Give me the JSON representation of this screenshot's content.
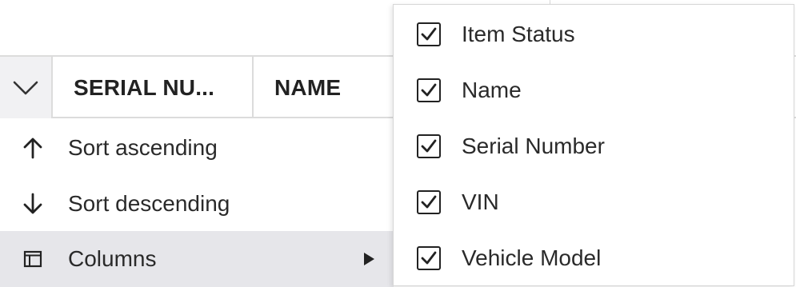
{
  "grid": {
    "headers": [
      {
        "label": "SERIAL NU..."
      },
      {
        "label": "NAME"
      }
    ]
  },
  "menu": {
    "items": [
      {
        "label": "Sort ascending",
        "icon": "arrow-up-icon"
      },
      {
        "label": "Sort descending",
        "icon": "arrow-down-icon"
      },
      {
        "label": "Columns",
        "icon": "columns-icon",
        "has_submenu": true,
        "active": true
      }
    ]
  },
  "columns_panel": {
    "options": [
      {
        "label": "Item Status",
        "checked": true
      },
      {
        "label": "Name",
        "checked": true
      },
      {
        "label": "Serial Number",
        "checked": true
      },
      {
        "label": "VIN",
        "checked": true
      },
      {
        "label": "Vehicle Model",
        "checked": true
      }
    ]
  },
  "colors": {
    "border": "#dcdcdc",
    "active_item_bg": "#e6e6ea",
    "toggle_cell_bg": "#f1f1f3",
    "text": "#222222"
  }
}
